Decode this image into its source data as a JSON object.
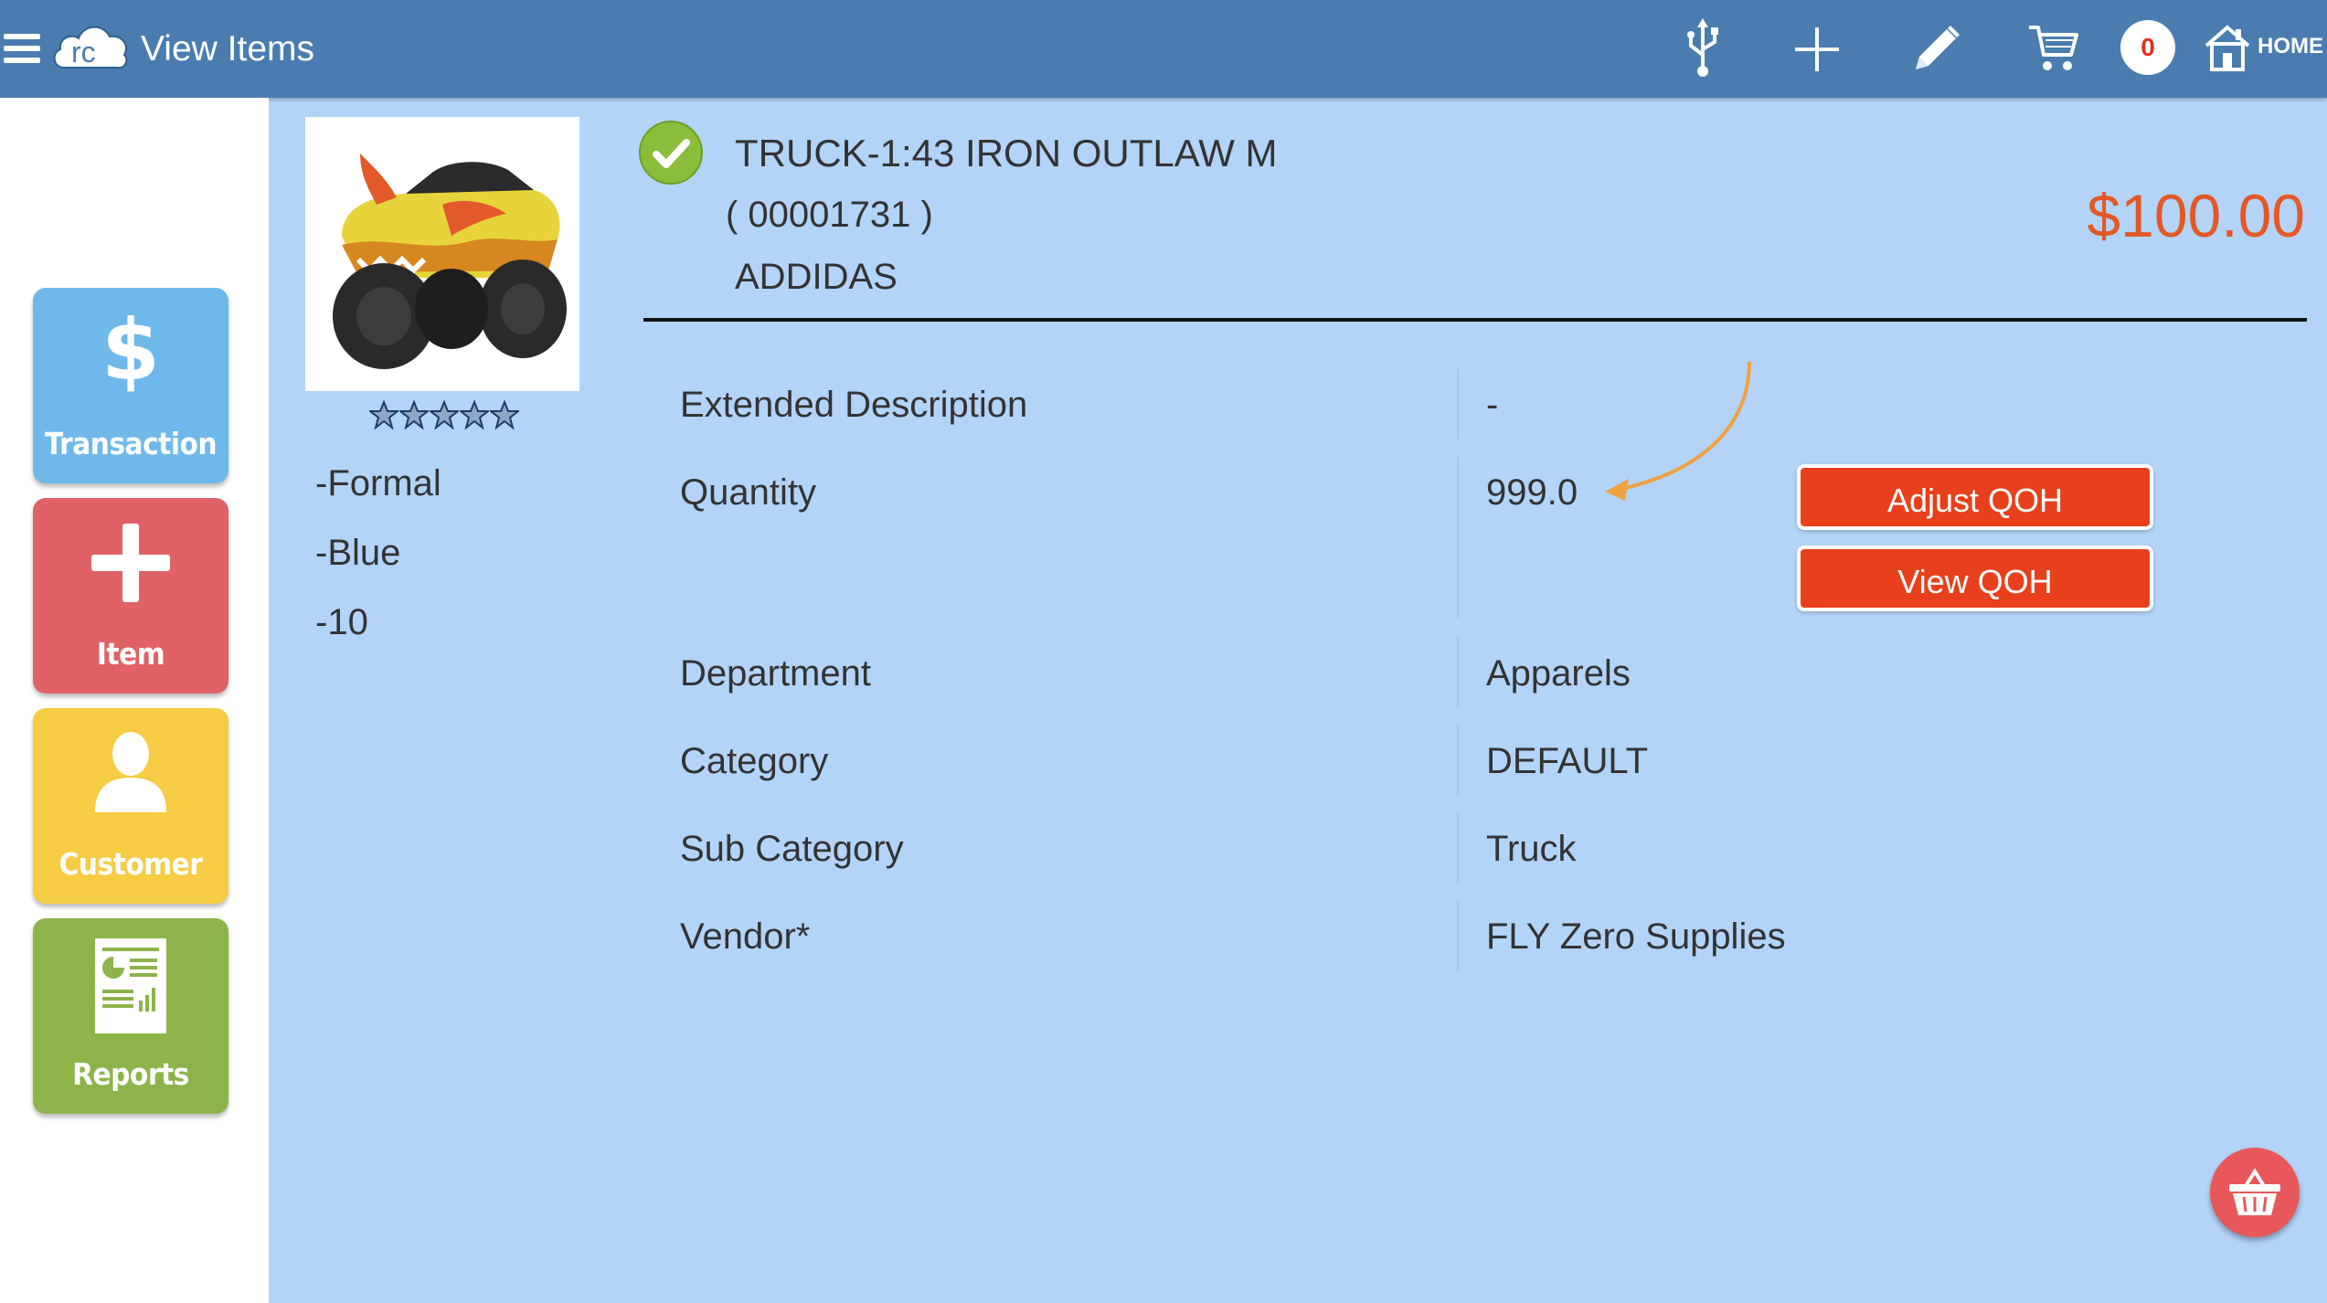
{
  "header": {
    "app_title": "View Items",
    "badge_count": "0",
    "home_label": "HOME",
    "icons": [
      "menu-icon",
      "rc-cloud-logo",
      "usb-icon",
      "plus-icon",
      "pencil-icon",
      "cart-icon",
      "home-icon"
    ]
  },
  "sidebar": {
    "items": [
      {
        "label": "Transaction",
        "icon": "dollar-icon",
        "color": "#6fb9ea"
      },
      {
        "label": "Item",
        "icon": "plus-icon",
        "color": "#e06266"
      },
      {
        "label": "Customer",
        "icon": "person-icon",
        "color": "#f6cc44"
      },
      {
        "label": "Reports",
        "icon": "report-icon",
        "color": "#8db44a"
      }
    ]
  },
  "product": {
    "name": "TRUCK-1:43 IRON OUTLAW M",
    "code": "( 00001731 )",
    "brand": "ADDIDAS",
    "price": "$100.00",
    "rating_stars": 5,
    "attributes": [
      "-Formal",
      "-Blue",
      "-10"
    ]
  },
  "details": {
    "extended_description": {
      "label": "Extended Description",
      "value": "-"
    },
    "quantity": {
      "label": "Quantity",
      "value": "999.0"
    },
    "department": {
      "label": "Department",
      "value": "Apparels"
    },
    "category": {
      "label": "Category",
      "value": "DEFAULT"
    },
    "sub_category": {
      "label": "Sub Category",
      "value": "Truck"
    },
    "vendor": {
      "label": "Vendor*",
      "value": "FLY Zero Supplies"
    }
  },
  "actions": {
    "adjust_qoh": "Adjust QOH",
    "view_qoh": "View QOH"
  },
  "colors": {
    "topbar": "#4a7cb0",
    "content_bg": "#b3d4f7",
    "price": "#e35826",
    "qoh_button": "#e8401c",
    "annotation_arrow": "#f0a040"
  }
}
